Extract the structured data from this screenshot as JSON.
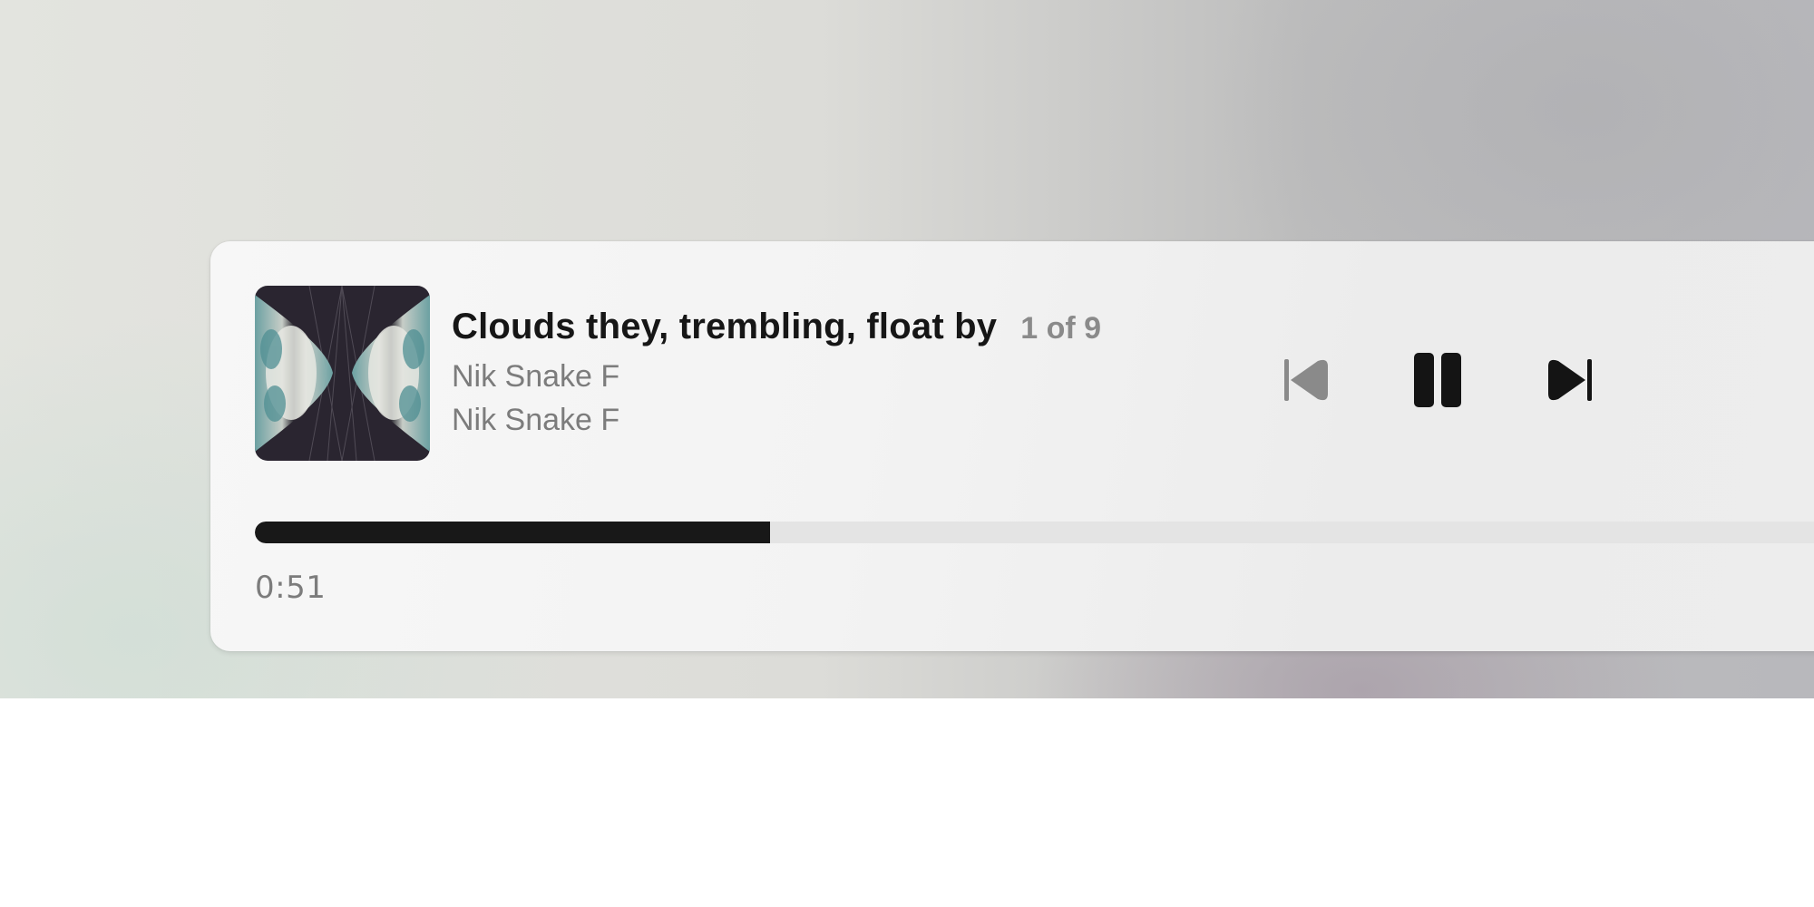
{
  "track": {
    "title": "Clouds they, trembling, float by",
    "position_label": "1 of 9",
    "artist": "Nik Snake F",
    "album": "Nik Snake F"
  },
  "playback": {
    "elapsed": "0:51",
    "progress_fraction": 0.3245,
    "state": "playing"
  },
  "controls": {
    "previous_icon": "skip-previous-icon",
    "pause_icon": "pause-icon",
    "next_icon": "skip-next-icon"
  },
  "colors": {
    "accent": "#181818",
    "secondary_text": "#7c7c7c",
    "track_bg": "#e4e4e4"
  }
}
